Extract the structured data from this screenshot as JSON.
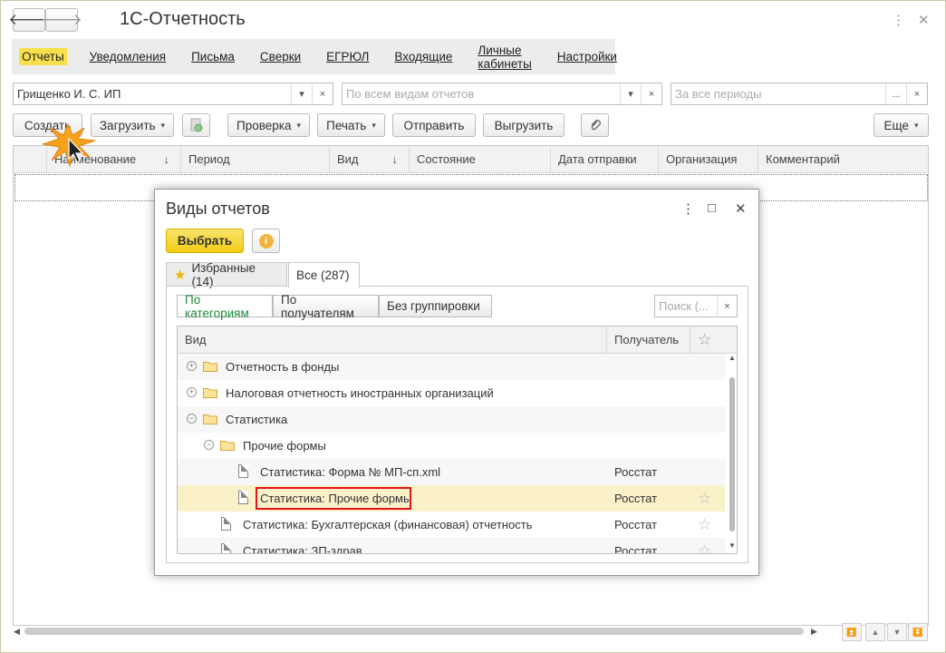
{
  "app": {
    "title": "1С-Отчетность",
    "back_glyph": "🡐",
    "forward_glyph": "🡒",
    "more_glyph": "⋮",
    "close_glyph": "✕"
  },
  "menu": [
    {
      "label": "Отчеты",
      "active": true
    },
    {
      "label": "Уведомления"
    },
    {
      "label": "Письма"
    },
    {
      "label": "Сверки"
    },
    {
      "label": "ЕГРЮЛ"
    },
    {
      "label": "Входящие"
    },
    {
      "label": "Личные кабинеты"
    },
    {
      "label": "Настройки"
    }
  ],
  "filters": {
    "organization": "Грищенко И. С. ИП",
    "report_types_placeholder": "По всем видам отчетов",
    "periods_placeholder": "За все периоды",
    "dots": "...",
    "clear": "×",
    "dropdown": "▾"
  },
  "toolbar": {
    "create": "Создать",
    "load": "Загрузить",
    "check": "Проверка",
    "print": "Печать",
    "send": "Отправить",
    "export": "Выгрузить",
    "more": "Еще",
    "dropdown": "▾"
  },
  "grid": {
    "columns": [
      {
        "label": "Наименование",
        "sort": "↓"
      },
      {
        "label": "Период"
      },
      {
        "label": "Вид",
        "sort": "↓"
      },
      {
        "label": "Состояние"
      },
      {
        "label": "Дата отправки"
      },
      {
        "label": "Организация"
      },
      {
        "label": "Комментарий"
      }
    ]
  },
  "dialog": {
    "title": "Виды отчетов",
    "select_label": "Выбрать",
    "info_glyph": "i",
    "more_glyph": "⋮",
    "maximize_glyph": "□",
    "close_glyph": "✕",
    "tabs": [
      {
        "label": "Избранные (14)",
        "active": false
      },
      {
        "label": "Все (287)",
        "active": true
      }
    ],
    "grouping": [
      "По категориям",
      "По получателям",
      "Без группировки"
    ],
    "search_placeholder": "Поиск (...",
    "search_clear": "×",
    "columns": {
      "kind": "Вид",
      "recipient": "Получатель",
      "star": "☆"
    },
    "rows": [
      {
        "name": "Отчетность в фонды",
        "type": "folder",
        "expander": "+",
        "recipient": ""
      },
      {
        "name": "Налоговая отчетность иностранных организаций",
        "type": "folder",
        "expander": "+",
        "recipient": ""
      },
      {
        "name": "Статистика",
        "type": "folder",
        "expander": "−",
        "recipient": ""
      },
      {
        "name": "Прочие формы",
        "type": "folder",
        "expander": "−",
        "recipient": ""
      },
      {
        "name": "Статистика: Форма № МП-сп.xml",
        "type": "doc",
        "recipient": "Росстат"
      },
      {
        "name": "Статистика: Прочие формы",
        "type": "doc",
        "recipient": "Росстат",
        "star": "☆",
        "selected": true
      },
      {
        "name": "Статистика: Бухгалтерская (финансовая) отчетность",
        "type": "doc",
        "recipient": "Росстат",
        "star": "☆"
      },
      {
        "name": "Статистика: ЗП-здрав",
        "type": "doc",
        "recipient": "Росстат",
        "star": "☆"
      }
    ]
  }
}
